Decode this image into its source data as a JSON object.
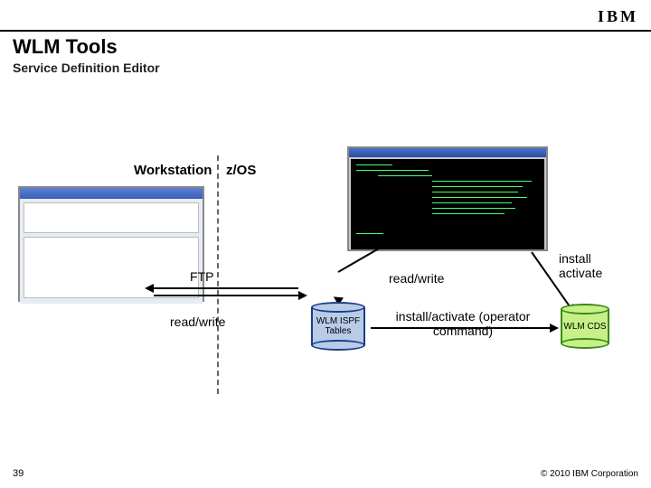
{
  "header": {
    "logo": "IBM"
  },
  "title": "WLM Tools",
  "subtitle": "Service Definition Editor",
  "labels": {
    "workstation": "Workstation",
    "zos": "z/OS",
    "ftp": "FTP",
    "read_write_left": "read/write",
    "read_write_right": "read/write",
    "install_activate_top": "install activate",
    "install_activate_cmd": "install/activate (operator command)"
  },
  "cylinders": {
    "ispf": "WLM ISPF Tables",
    "cds": "WLM CDS"
  },
  "footer": {
    "page_num": "39",
    "copyright": "© 2010 IBM Corporation"
  }
}
